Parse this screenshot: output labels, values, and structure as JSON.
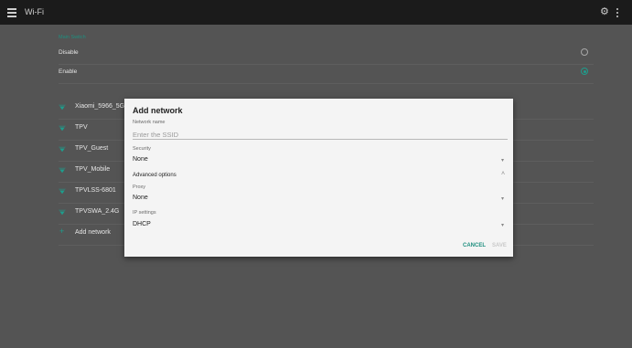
{
  "header": {
    "title": "Wi-Fi"
  },
  "main_switch": {
    "section_label": "Main Switch",
    "options": [
      {
        "label": "Disable",
        "selected": false
      },
      {
        "label": "Enable",
        "selected": true
      }
    ]
  },
  "networks": [
    "Xiaomi_5966_5G",
    "TPV",
    "TPV_Guest",
    "TPV_Mobile",
    "TPVLSS-6801",
    "TPVSWA_2.4G"
  ],
  "add_network_label": "Add network",
  "dialog": {
    "title": "Add network",
    "network_name_label": "Network name",
    "ssid_placeholder": "Enter the SSID",
    "security_label": "Security",
    "security_value": "None",
    "advanced_label": "Advanced options",
    "proxy_label": "Proxy",
    "proxy_value": "None",
    "ip_label": "IP settings",
    "ip_value": "DHCP",
    "cancel": "CANCEL",
    "save": "SAVE"
  },
  "colors": {
    "accent": "#1f9c8c",
    "topbar": "#1b1b1b",
    "background": "#545454"
  },
  "icons": {
    "menu": "menu-icon",
    "settings": "gear-icon",
    "more": "more-vert-icon",
    "wifi": "wifi-signal-icon",
    "add": "plus-icon"
  }
}
